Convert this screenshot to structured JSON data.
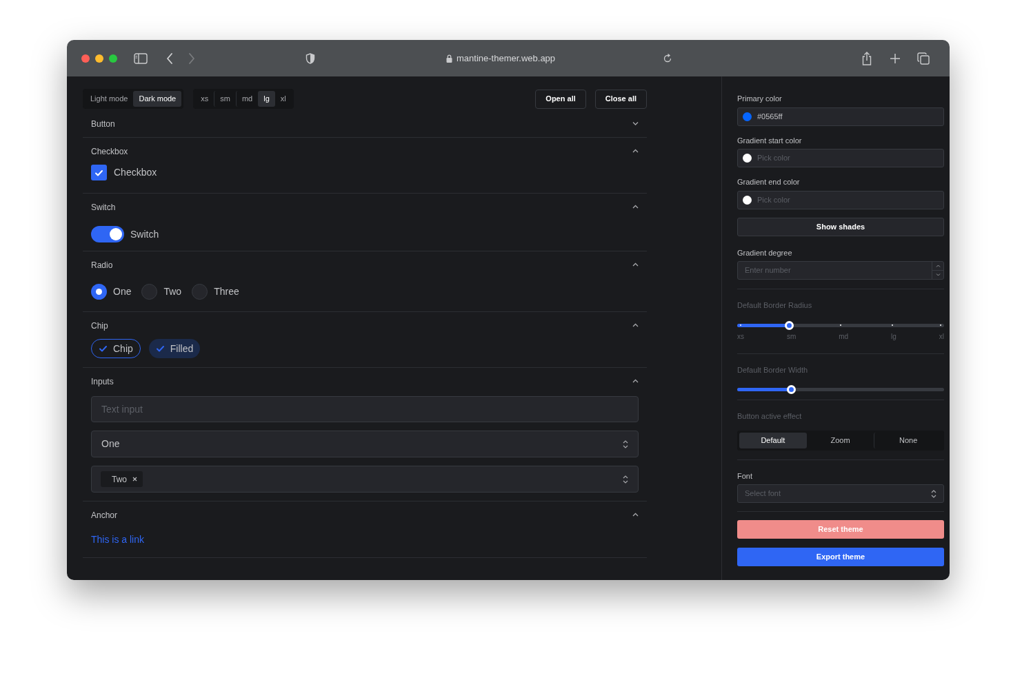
{
  "browser": {
    "url": "mantine-themer.web.app",
    "forward_disabled": true
  },
  "toolbar": {
    "color_scheme": [
      {
        "label": "Light mode",
        "selected": false
      },
      {
        "label": "Dark mode",
        "selected": true
      }
    ],
    "sizes": [
      {
        "label": "xs",
        "selected": false
      },
      {
        "label": "sm",
        "selected": false
      },
      {
        "label": "md",
        "selected": false
      },
      {
        "label": "lg",
        "selected": true
      },
      {
        "label": "xl",
        "selected": false
      }
    ],
    "buttons": [
      "Open all",
      "Close all"
    ]
  },
  "sections": [
    {
      "kind": "button",
      "title": "Button",
      "expanded": false
    },
    {
      "kind": "checkbox",
      "title": "Checkbox",
      "expanded": true,
      "label": "Checkbox",
      "checked": true
    },
    {
      "kind": "switch",
      "title": "Switch",
      "expanded": true,
      "label": "Switch",
      "on": true
    },
    {
      "kind": "radio",
      "title": "Radio",
      "expanded": true,
      "options": [
        {
          "label": "One",
          "selected": true
        },
        {
          "label": "Two",
          "selected": false
        },
        {
          "label": "Three",
          "selected": false
        }
      ]
    },
    {
      "kind": "chip",
      "title": "Chip",
      "expanded": true,
      "chips": [
        {
          "label": "Chip",
          "kind": "outline",
          "checked": true
        },
        {
          "label": "Filled",
          "kind": "filled",
          "checked": true
        }
      ]
    },
    {
      "kind": "inputs",
      "title": "Inputs",
      "expanded": true,
      "text_input": {
        "placeholder": "Text input"
      },
      "select": {
        "value": "One"
      },
      "multiselect": {
        "values": [
          "Two"
        ]
      }
    },
    {
      "kind": "anchor",
      "title": "Anchor",
      "expanded": true,
      "link": "This is a link"
    }
  ],
  "settings": {
    "primary_color": {
      "label": "Primary color",
      "value": "#0565ff",
      "color": "#0565ff"
    },
    "gradient_start": {
      "label": "Gradient start color",
      "placeholder": "Pick color"
    },
    "gradient_end": {
      "label": "Gradient end color",
      "placeholder": "Pick color"
    },
    "show_shades": "Show shades",
    "gradient_degree": {
      "label": "Gradient degree",
      "placeholder": "Enter number"
    },
    "border_radius": {
      "label": "Default Border Radius",
      "disabled": true,
      "marks": [
        "xs",
        "sm",
        "md",
        "lg",
        "xl"
      ],
      "level": 0.25
    },
    "border_width": {
      "label": "Default Border Width",
      "disabled": true,
      "level": 0.26
    },
    "active_effect": {
      "label": "Button active effect",
      "disabled": true,
      "options": [
        {
          "label": "Default",
          "selected": true
        },
        {
          "label": "Zoom",
          "selected": false
        },
        {
          "label": "None",
          "selected": false
        }
      ]
    },
    "font": {
      "label": "Font",
      "placeholder": "Select font"
    },
    "reset": "Reset theme",
    "export": "Export theme"
  }
}
